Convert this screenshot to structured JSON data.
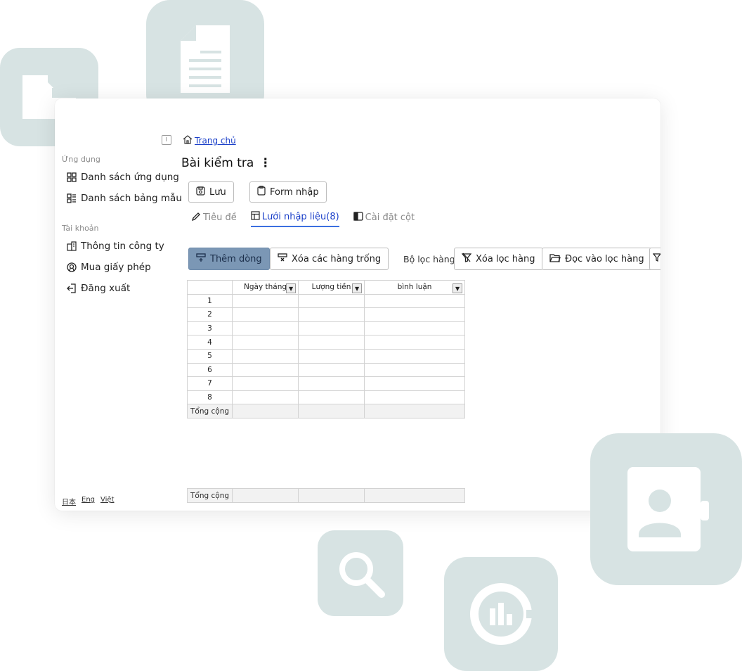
{
  "sidebar": {
    "sections": [
      {
        "title": "Ứng dụng",
        "items": [
          "Danh sách ứng dụng",
          "Danh sách bảng mẫu"
        ]
      },
      {
        "title": "Tài khoản",
        "items": [
          "Thông tin công ty",
          "Mua giấy phép",
          "Đăng xuất"
        ]
      }
    ],
    "languages": [
      "日本",
      "Eng",
      "Việt"
    ]
  },
  "breadcrumb": {
    "home": "Trang chủ"
  },
  "page": {
    "title": "Bài kiểm tra",
    "menu_glyph": "⋮"
  },
  "actions": {
    "save": "Lưu",
    "form_input": "Form nhập"
  },
  "tabs": [
    {
      "label": "Tiêu đề",
      "active": false
    },
    {
      "label": "Lưới nhập liệu(8)",
      "active": true
    },
    {
      "label": "Cài đặt cột",
      "active": false
    }
  ],
  "toolbar": {
    "add_row": "Thêm dòng",
    "delete_empty_rows": "Xóa các hàng trống",
    "row_filter_label": "Bộ lọc hàng",
    "clear_filter": "Xóa lọc hàng",
    "load_filter": "Đọc vào lọc hàng"
  },
  "grid": {
    "columns": [
      "Ngày tháng",
      "Lượng tiền",
      "bình luận"
    ],
    "rows": [
      "1",
      "2",
      "3",
      "4",
      "5",
      "6",
      "7",
      "8"
    ],
    "total_label": "Tổng cộng",
    "footer_total_label": "Tổng cộng"
  },
  "icons": [
    "folder-icon",
    "document-icon",
    "contact-book-icon",
    "search-icon",
    "chart-icon"
  ],
  "colors": {
    "tile": "#d7e3e3",
    "accent": "#1a3fc9",
    "primary_button": "#7b97b5"
  }
}
